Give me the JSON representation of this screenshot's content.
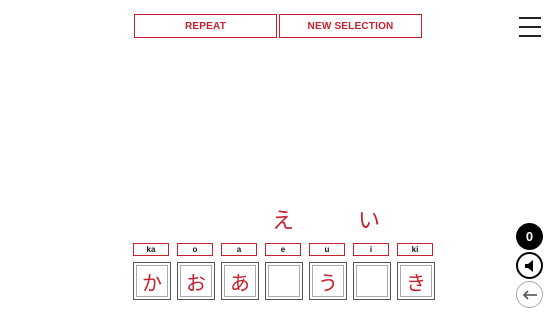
{
  "toolbar": {
    "repeat_label": "REPEAT",
    "new_selection_label": "NEW SELECTION"
  },
  "menu_icon": "hamburger-menu-icon",
  "floating_kana": [
    "え",
    "い"
  ],
  "romaji_labels": [
    "ka",
    "o",
    "a",
    "e",
    "u",
    "i",
    "ki"
  ],
  "slots": [
    "か",
    "お",
    "あ",
    "",
    "う",
    "",
    "き"
  ],
  "score": "0",
  "icons": {
    "sound": "speaker-icon",
    "back": "arrow-left-icon"
  },
  "colors": {
    "accent": "#c8202e",
    "text": "#111111",
    "score_bg": "#000000"
  }
}
